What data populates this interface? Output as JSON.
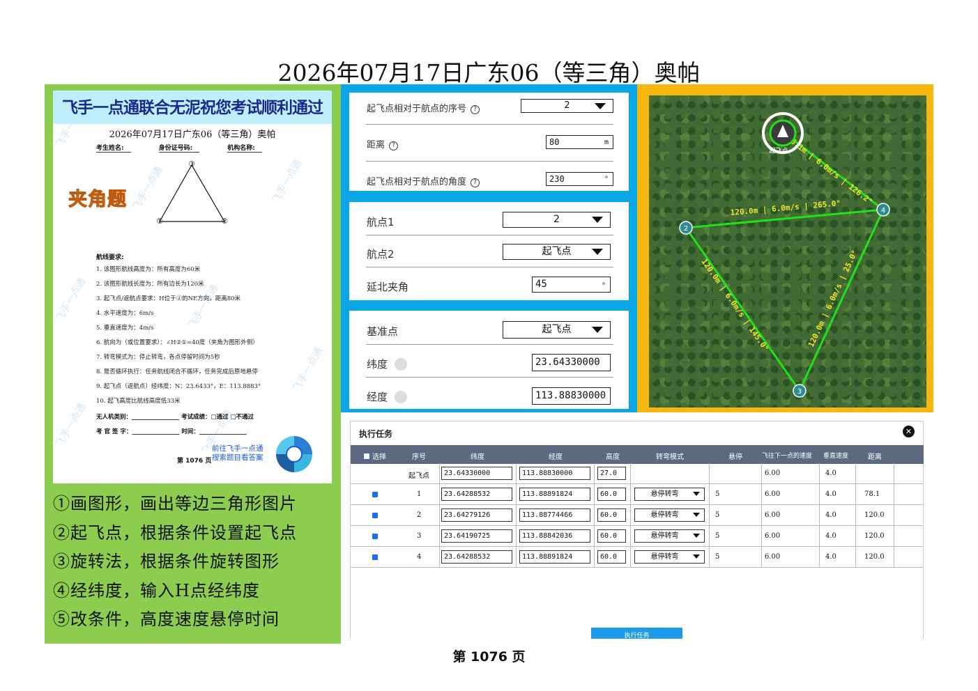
{
  "page_title": "2026年07月17日广东06（等三角）奥帕",
  "paper": {
    "banner": "飞手一点通联合无泥祝您考试顺利通过",
    "title": "2026年07月17日广东06（等三角）奥帕",
    "info_name": "考生姓名:",
    "info_id": "身份证号码:",
    "info_org": "机构名称:",
    "triangle_labels": [
      "③",
      "①",
      "②"
    ],
    "stamp": "夹角题",
    "req_head": "航线要求:",
    "requirements": [
      "1.  该图形航线高度为：所有高度为60米",
      "2.  该图形航线长度为：所有边长为120米",
      "3.  起飞点/返航点要求：H位于②的NE方向，距离80米",
      "4.  水平速度为：6m/s",
      "5.  垂直速度为：4m/s",
      "6.  航向为（或位置要求）：∠H②①=40度（夹角为图形外侧）",
      "7.  转弯模式为：停止转弯，各点停留时间为5秒",
      "8.  是否循环执行：任务航线闭合不循环，任务完成后原地悬停",
      "9.  起飞点（返航点）经纬度：N：23.6433°，E：113.8883°",
      "10. 起飞高度比航线高度低33米"
    ],
    "foot1": "无人机类别：________________  考试成绩：□通过  □不通过",
    "foot2": "考 官 签 字：________________  时间：________________",
    "link1": "前往飞手一点通",
    "link2": "搜索题目看答案",
    "page": "第 1076 页",
    "watermark": "飞手一点通"
  },
  "steps": [
    "①画图形，画出等边三角形图片",
    "②起飞点，根据条件设置起飞点",
    "③旋转法，根据条件旋转图形",
    "④经纬度，输入H点经纬度",
    "⑤改条件，高度速度悬停时间"
  ],
  "card1": {
    "seq_label": "起飞点相对于航点的序号",
    "seq_value": "2",
    "dist_label": "距离",
    "dist_value": "80",
    "dist_unit": "m",
    "angle_label": "起飞点相对于航点的角度",
    "angle_value": "230",
    "angle_unit": "°",
    "help": "?"
  },
  "card2": {
    "wp1_label": "航点1",
    "wp1_value": "2",
    "wp2_label": "航点2",
    "wp2_value": "起飞点",
    "north_label": "延北夹角",
    "north_value": "45",
    "north_unit": "°"
  },
  "card3": {
    "base_label": "基准点",
    "base_value": "起飞点",
    "lat_label": "纬度",
    "lat_value": "23.64330000",
    "lon_label": "经度",
    "lon_value": "113.88830000"
  },
  "map": {
    "edge_h4": "76.1m | 6.0m/s | 126.2°",
    "edge_24": "120.0m | 6.0m/s | 265.0°",
    "edge_23": "120.0m | 6.0m/s | 145.0°",
    "edge_34": "120.0m | 6.0m/s | 25.0°",
    "node2": "2",
    "node3": "3",
    "node4": "4",
    "home_label": "起飞点"
  },
  "task": {
    "title": "执行任务",
    "close": "✕",
    "headers": [
      "选择",
      "序号",
      "纬度",
      "经度",
      "高度",
      "转弯模式",
      "悬停",
      "飞往下一点的速度",
      "垂直速度",
      "距离"
    ],
    "rows": [
      {
        "sel": false,
        "seq": "起飞点",
        "lat": "23.64330000",
        "lon": "113.88830000",
        "alt": "27.0",
        "turn": "",
        "hover": "",
        "speed": "6.00",
        "vspeed": "4.0",
        "dist": ""
      },
      {
        "sel": true,
        "seq": "1",
        "lat": "23.64288532",
        "lon": "113.88891824",
        "alt": "60.0",
        "turn": "悬停转弯",
        "hover": "5",
        "speed": "6.00",
        "vspeed": "4.0",
        "dist": "78.1"
      },
      {
        "sel": true,
        "seq": "2",
        "lat": "23.64279126",
        "lon": "113.88774466",
        "alt": "60.0",
        "turn": "悬停转弯",
        "hover": "5",
        "speed": "6.00",
        "vspeed": "4.0",
        "dist": "120.0"
      },
      {
        "sel": true,
        "seq": "3",
        "lat": "23.64190725",
        "lon": "113.88842036",
        "alt": "60.0",
        "turn": "悬停转弯",
        "hover": "5",
        "speed": "6.00",
        "vspeed": "4.0",
        "dist": "120.0"
      },
      {
        "sel": true,
        "seq": "4",
        "lat": "23.64288532",
        "lon": "113.88891824",
        "alt": "60.0",
        "turn": "悬停转弯",
        "hover": "5",
        "speed": "6.00",
        "vspeed": "4.0",
        "dist": "120.0"
      }
    ],
    "exec_label": "执行任务"
  },
  "bottom_page": "第 1076 页",
  "colors": {
    "green": "#8ccc4e",
    "blue": "#0aa6e6",
    "yellow": "#f6b80e",
    "route": "#22e01a",
    "label": "#f3e62a"
  }
}
